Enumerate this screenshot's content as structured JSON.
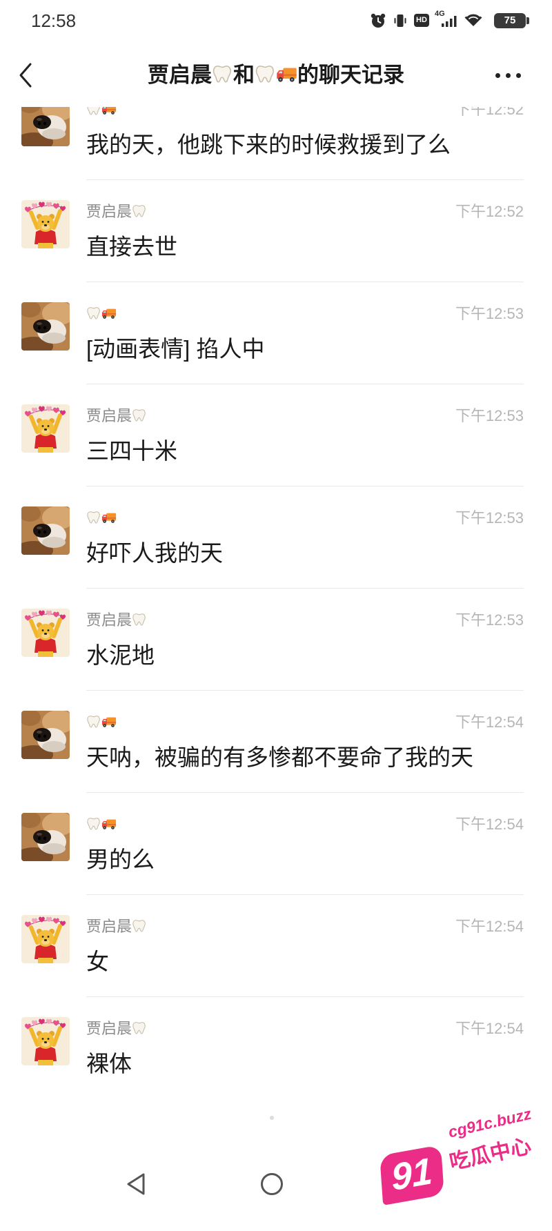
{
  "status_bar": {
    "time": "12:58",
    "hd_label": "HD",
    "network": "4G",
    "battery": "75",
    "icons": [
      "alarm-icon",
      "vibrate-icon",
      "hd-icon",
      "signal-icon",
      "wifi-icon",
      "battery-icon"
    ]
  },
  "header": {
    "title": "贾启晨🦷和🦷🚚的聊天记录",
    "back_icon": "chevron-left-icon",
    "more_icon": "more-horizontal-icon"
  },
  "messages": [
    {
      "sender": "🦷🚚",
      "time": "下午12:52",
      "text": "我的天，他跳下来的时候救援到了么",
      "avatar": "puppy-avatar"
    },
    {
      "sender": "贾启晨🦷",
      "time": "下午12:52",
      "text": "直接去世",
      "avatar": "pooh-avatar"
    },
    {
      "sender": "🦷🚚",
      "time": "下午12:53",
      "text": "[动画表情] 掐人中",
      "avatar": "puppy-avatar"
    },
    {
      "sender": "贾启晨🦷",
      "time": "下午12:53",
      "text": "三四十米",
      "avatar": "pooh-avatar"
    },
    {
      "sender": "🦷🚚",
      "time": "下午12:53",
      "text": "好吓人我的天",
      "avatar": "puppy-avatar"
    },
    {
      "sender": "贾启晨🦷",
      "time": "下午12:53",
      "text": "水泥地",
      "avatar": "pooh-avatar"
    },
    {
      "sender": "🦷🚚",
      "time": "下午12:54",
      "text": "天呐，被骗的有多惨都不要命了我的天",
      "avatar": "puppy-avatar"
    },
    {
      "sender": "🦷🚚",
      "time": "下午12:54",
      "text": "男的么",
      "avatar": "puppy-avatar"
    },
    {
      "sender": "贾启晨🦷",
      "time": "下午12:54",
      "text": "女",
      "avatar": "pooh-avatar"
    },
    {
      "sender": "贾启晨🦷",
      "time": "下午12:54",
      "text": "裸体",
      "avatar": "pooh-avatar"
    }
  ],
  "nav_bar": {
    "back_icon": "triangle-back-icon",
    "home_icon": "circle-home-icon",
    "recents_icon": "square-recents-icon"
  },
  "watermark": {
    "logo_number": "91",
    "domain": "cg91c.buzz",
    "name": "吃瓜中心",
    "color": "#ec2d87"
  }
}
